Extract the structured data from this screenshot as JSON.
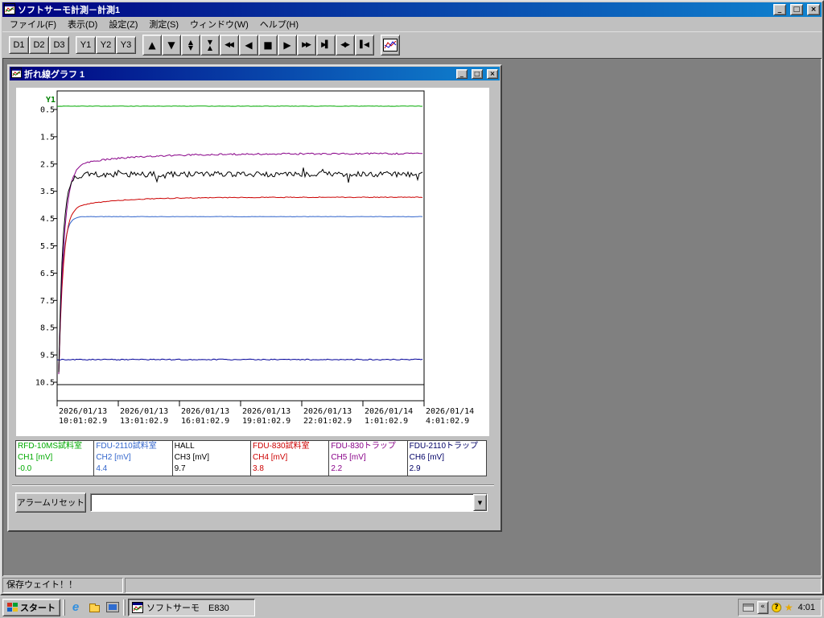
{
  "window": {
    "title": "ソフトサーモ計測－計測1",
    "controls": {
      "minimize": "_",
      "maximize": "□",
      "close": "×"
    }
  },
  "menu": {
    "items": [
      {
        "label": "ファイル(F)"
      },
      {
        "label": "表示(D)"
      },
      {
        "label": "設定(Z)"
      },
      {
        "label": "測定(S)"
      },
      {
        "label": "ウィンドウ(W)"
      },
      {
        "label": "ヘルプ(H)"
      }
    ]
  },
  "toolbar": {
    "display_buttons": [
      {
        "label": "D1"
      },
      {
        "label": "D2"
      },
      {
        "label": "D3"
      }
    ],
    "axis_buttons": [
      {
        "label": "Y1"
      },
      {
        "label": "Y2"
      },
      {
        "label": "Y3"
      }
    ],
    "nav_buttons": [
      {
        "name": "scroll-up",
        "glyph": "▲"
      },
      {
        "name": "scroll-down",
        "glyph": "▼"
      },
      {
        "name": "scroll-vertical",
        "glyph_top": "▲",
        "glyph_bottom": "▼"
      },
      {
        "name": "hourglass",
        "glyph_top": "▼",
        "glyph_bottom": "▲"
      },
      {
        "name": "fast-rewind",
        "glyph": "◀◀"
      },
      {
        "name": "step-back",
        "glyph": "◀"
      },
      {
        "name": "stop",
        "glyph": "■"
      },
      {
        "name": "step-forward",
        "glyph": "▶"
      },
      {
        "name": "fast-forward",
        "glyph": "▶▶"
      },
      {
        "name": "skip-to-end",
        "glyph": "▶▌"
      },
      {
        "name": "expand-range",
        "glyph": "◀▶"
      },
      {
        "name": "skip-to-start",
        "glyph": "▌◀"
      }
    ]
  },
  "graph_window": {
    "title": "折れ線グラフ 1",
    "controls": {
      "minimize": "_",
      "maximize": "□",
      "close": "×"
    }
  },
  "chart_data": {
    "type": "line",
    "title": "折れ線グラフ 1",
    "y_axis_label": "Y1",
    "y_axis_label_color": "#008000",
    "y_ticks": [
      0.5,
      1.5,
      2.5,
      3.5,
      4.5,
      5.5,
      6.5,
      7.5,
      8.5,
      9.5,
      10.5
    ],
    "y_axis_inverted": true,
    "grid": false,
    "x_ticks": [
      {
        "date": "2026/01/13",
        "time": "10:01:02.9"
      },
      {
        "date": "2026/01/13",
        "time": "13:01:02.9"
      },
      {
        "date": "2026/01/13",
        "time": "16:01:02.9"
      },
      {
        "date": "2026/01/13",
        "time": "19:01:02.9"
      },
      {
        "date": "2026/01/13",
        "time": "22:01:02.9"
      },
      {
        "date": "2026/01/14",
        "time": "1:01:02.9"
      },
      {
        "date": "2026/01/14",
        "time": "4:01:02.9"
      }
    ],
    "series": [
      {
        "channel": "CH1",
        "device": "RFD-10MS試料室",
        "unit": "mV",
        "current_value": "-0.0",
        "color": "#00aa00",
        "shape": "flat",
        "start": 0.38,
        "level": 0.38,
        "tau": 5,
        "noise": 0.006
      },
      {
        "channel": "CH2",
        "device": "FDU-2110試料室",
        "unit": "mV",
        "current_value": "4.4",
        "color": "#3366cc",
        "shape": "rise-settle",
        "start": 10.2,
        "level": 4.43,
        "tau": 4.5,
        "noise": 0.008
      },
      {
        "channel": "CH3",
        "device": "HALL",
        "unit": "mV",
        "current_value": "9.7",
        "color": "#000099",
        "shape": "flat",
        "start": 9.67,
        "level": 9.67,
        "tau": 5,
        "noise": 0.018
      },
      {
        "channel": "CH4",
        "device": "FDU-830試料室",
        "unit": "mV",
        "current_value": "3.8",
        "color": "#cc0000",
        "shape": "rise-settle",
        "start": 10.2,
        "level": 3.72,
        "tau": 5.5,
        "drift": 0.45,
        "dtau": 55,
        "noise": 0.014
      },
      {
        "channel": "CH5",
        "device": "FDU-830トラップ",
        "unit": "mV",
        "current_value": "2.2",
        "color": "#880088",
        "shape": "rise-settle",
        "start": 10.2,
        "level": 2.12,
        "tau": 6.5,
        "drift": 0.5,
        "dtau": 70,
        "noise": 0.03
      },
      {
        "channel": "CH6",
        "device": "FDU-2110トラップ",
        "unit": "mV",
        "current_value": "2.9",
        "color": "#000000",
        "shape": "rise-settle-noisy",
        "start": 10.2,
        "level": 2.88,
        "tau": 5,
        "noise": 0.1,
        "spikes": true
      }
    ]
  },
  "legend": {
    "channels": [
      {
        "device": "RFD-10MS試料室",
        "channel": "CH1 [mV]",
        "value": "-0.0",
        "color": "#00aa00"
      },
      {
        "device": "FDU-2110試料室",
        "channel": "CH2 [mV]",
        "value": "4.4",
        "color": "#3366cc"
      },
      {
        "device": "HALL",
        "channel": "CH3 [mV]",
        "value": "9.7",
        "color": "#000000"
      },
      {
        "device": "FDU-830試料室",
        "channel": "CH4 [mV]",
        "value": "3.8",
        "color": "#cc0000"
      },
      {
        "device": "FDU-830トラップ",
        "channel": "CH5 [mV]",
        "value": "2.2",
        "color": "#880088"
      },
      {
        "device": "FDU-2110トラップ",
        "channel": "CH6 [mV]",
        "value": "2.9",
        "color": "#000066"
      }
    ]
  },
  "alarm_bar": {
    "reset_button": "アラームリセット",
    "combo_value": "",
    "dropdown_glyph": "▼"
  },
  "status_bar": {
    "message": "保存ウェイト！！"
  },
  "taskbar": {
    "start_label": "スタート",
    "quick_launch": [
      {
        "name": "internet-explorer",
        "glyph": "e"
      },
      {
        "name": "folder"
      },
      {
        "name": "desktop"
      }
    ],
    "task_button": {
      "label": "ソフトサーモ　E830"
    },
    "tray": {
      "collapse_glyph": "«",
      "help_glyph": "?",
      "star_glyph": "★",
      "clock": "4:01"
    }
  }
}
